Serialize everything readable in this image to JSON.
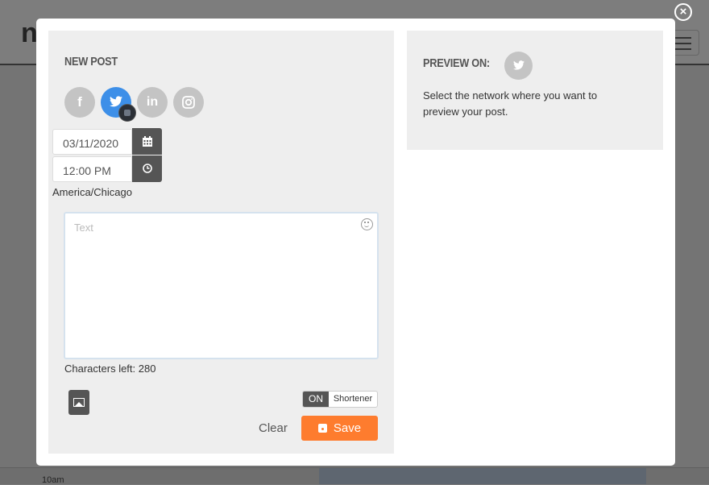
{
  "background": {
    "logo_text": "n",
    "time_label": "10am"
  },
  "modal": {
    "close_icon": "close-circle-icon",
    "new_post": {
      "title": "NEW POST",
      "networks": [
        {
          "name": "facebook",
          "glyph": "f",
          "active": false
        },
        {
          "name": "twitter",
          "glyph": "🐦",
          "active": true
        },
        {
          "name": "linkedin",
          "glyph": "in",
          "active": false
        },
        {
          "name": "instagram",
          "glyph": "◎",
          "active": false
        }
      ],
      "date_value": "03/11/2020",
      "time_value": "12:00 PM",
      "timezone": "America/Chicago",
      "text_placeholder": "Text",
      "characters_left_label": "Characters left: 280",
      "shortener_state": "ON",
      "shortener_label": "Shortener",
      "clear_label": "Clear",
      "save_label": "Save",
      "accent_color": "#fe7c2e",
      "twitter_color": "#3d8fe8"
    },
    "preview": {
      "title": "PREVIEW ON:",
      "network": "twitter",
      "description": "Select the network where you want to preview your post."
    }
  }
}
